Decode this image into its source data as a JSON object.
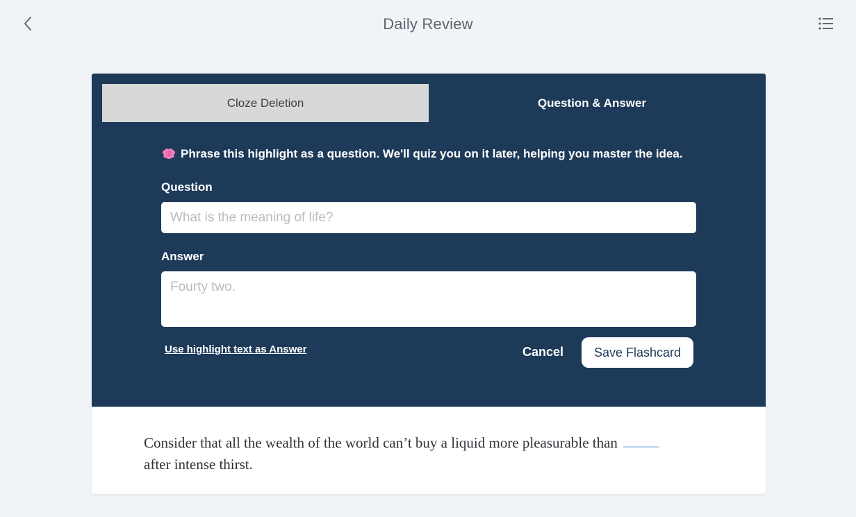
{
  "header": {
    "title": "Daily Review",
    "back_icon": "chevron-left-icon",
    "menu_icon": "list-icon"
  },
  "tabs": [
    {
      "label": "Cloze Deletion",
      "active": false
    },
    {
      "label": "Question & Answer",
      "active": true
    }
  ],
  "instruction": {
    "icon": "brain-icon",
    "text": "Phrase this highlight as a question. We'll quiz you on it later, helping you master the idea."
  },
  "form": {
    "question_label": "Question",
    "question_placeholder": "What is the meaning of life?",
    "question_value": "",
    "answer_label": "Answer",
    "answer_placeholder": "Fourty two.",
    "answer_value": ""
  },
  "actions": {
    "use_highlight_label": "Use highlight text as Answer",
    "cancel_label": "Cancel",
    "save_label": "Save Flashcard"
  },
  "passage": {
    "before_blank": "Consider that all the wealth of the world can’t buy a liquid more pleasurable than",
    "after_blank": "after intense thirst."
  },
  "colors": {
    "page_background": "#f1f4f7",
    "editor_background": "#1e3a59",
    "inactive_tab": "#d8d8d8",
    "blank_underline": "#b8d3ec"
  }
}
